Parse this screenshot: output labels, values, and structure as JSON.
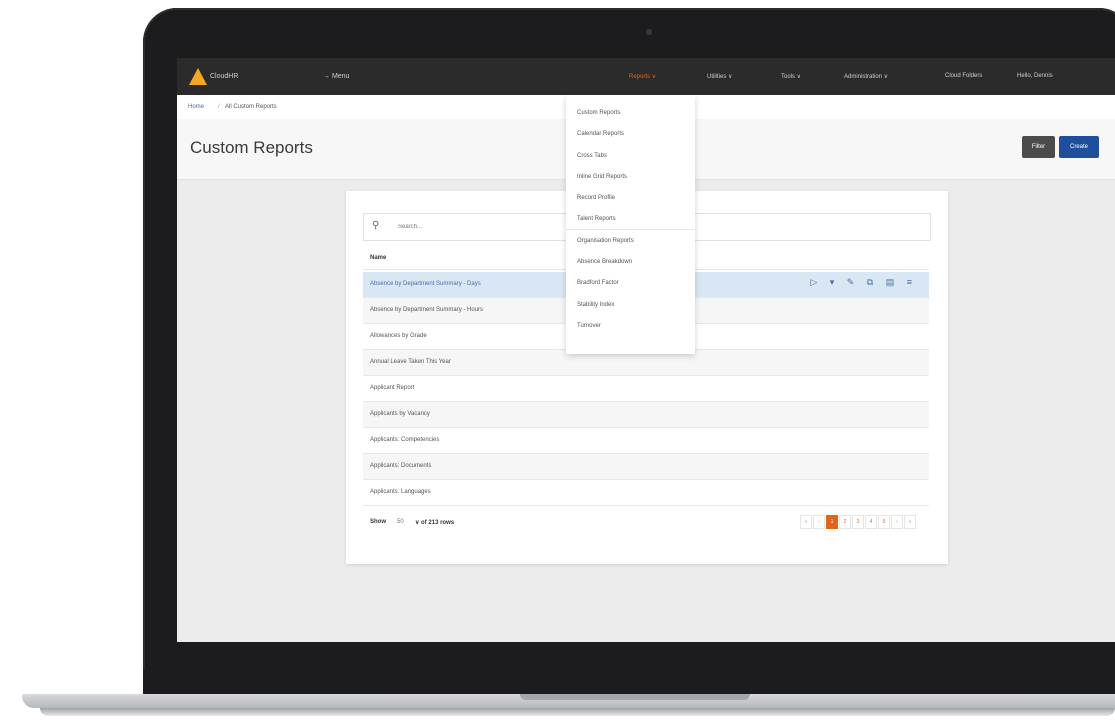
{
  "app": {
    "name": "CloudHR",
    "menu_label": "→ Menu"
  },
  "nav": {
    "reports": "Reports ∨",
    "utilities": "Utilities ∨",
    "tools": "Tools ∨",
    "administration": "Administration ∨",
    "cloud_folders": "Cloud Folders",
    "user": "Hello, Dennis"
  },
  "breadcrumb": {
    "home": "Home",
    "separator": "/",
    "current": "All Custom Reports"
  },
  "page": {
    "title": "Custom Reports",
    "filter_label": "Filter",
    "create_label": "Create"
  },
  "search": {
    "placeholder": "Search..."
  },
  "table": {
    "column_name": "Name",
    "rows": [
      "Absence by Department Summary - Days",
      "Absence by Department Summary - Hours",
      "Allowances by Grade",
      "Annual Leave Taken This Year",
      "Applicant Report",
      "Applicants by Vacancy",
      "Applicants: Competencies",
      "Applicants: Documents",
      "Applicants: Languages"
    ],
    "selected_row_index": 0,
    "row_actions": "▷ ▾ ✎ ⧉ ▤ ≡"
  },
  "footer": {
    "show_label": "Show",
    "show_count": "50",
    "rows_info": "∨ of 213 rows"
  },
  "pagination": [
    "«",
    "‹",
    "1",
    "2",
    "3",
    "4",
    "5",
    "›",
    "»"
  ],
  "pagination_active": "1",
  "reports_dropdown": {
    "items": [
      "Custom Reports",
      "Calendar Reports",
      "Cross Tabs",
      "Inline Grid Reports",
      "Record Profile",
      "Talent Reports",
      "Organisation Reports",
      "Absence Breakdown",
      "Bradford Factor",
      "Stability Index",
      "Turnover"
    ]
  },
  "colors": {
    "nav_bg": "#2b2b2b",
    "accent_orange": "#e2641c",
    "logo": "#f5a623",
    "create_button": "#1f4f9c",
    "selected_row": "#d9e7f5"
  }
}
